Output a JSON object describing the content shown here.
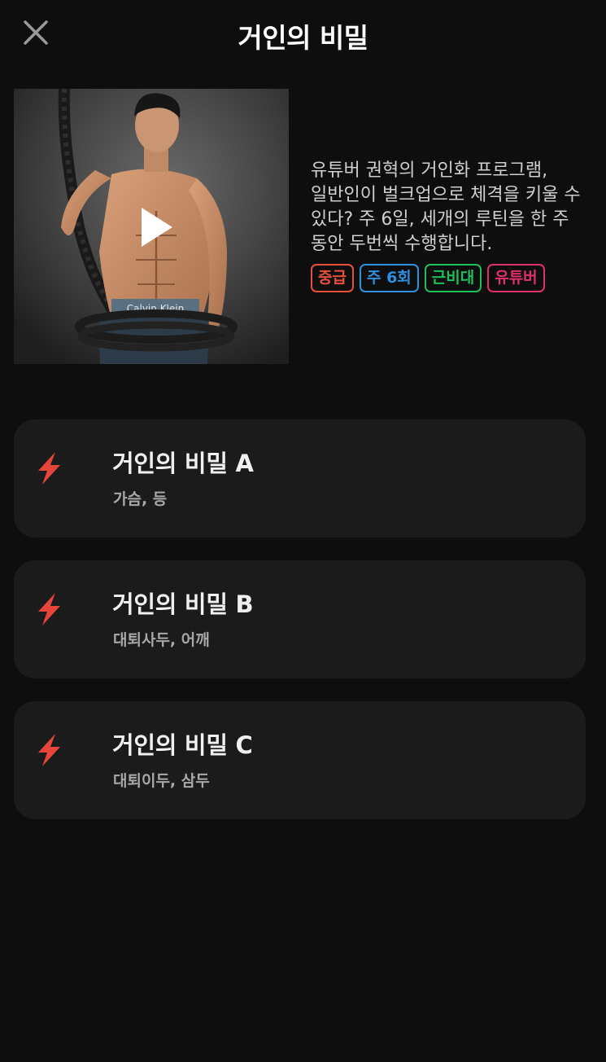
{
  "header": {
    "title": "거인의 비밀",
    "close_icon": "close-icon"
  },
  "program": {
    "description": "유튜버 권혁의 거인화 프로그램, 일반인이 벌크업으로 체격을 키울 수 있다? 주 6일, 세개의 루틴을 한 주 동안 두번씩 수행합니다.",
    "image_text": "Calvin Klein",
    "tags": [
      {
        "label": "중급",
        "color": "#e8503a"
      },
      {
        "label": "주 6회",
        "color": "#2f8fe0"
      },
      {
        "label": "근비대",
        "color": "#1fbf5a"
      },
      {
        "label": "유튜버",
        "color": "#e0306a"
      }
    ]
  },
  "routines": [
    {
      "title": "거인의 비밀 A",
      "subtitle": "가슴, 등",
      "icon": "lightning-icon"
    },
    {
      "title": "거인의 비밀 B",
      "subtitle": "대퇴사두, 어깨",
      "icon": "lightning-icon"
    },
    {
      "title": "거인의 비밀 C",
      "subtitle": "대퇴이두, 삼두",
      "icon": "lightning-icon"
    }
  ],
  "colors": {
    "background": "#0e0e0e",
    "card": "#1b1b1b",
    "accent": "#e8453a"
  }
}
